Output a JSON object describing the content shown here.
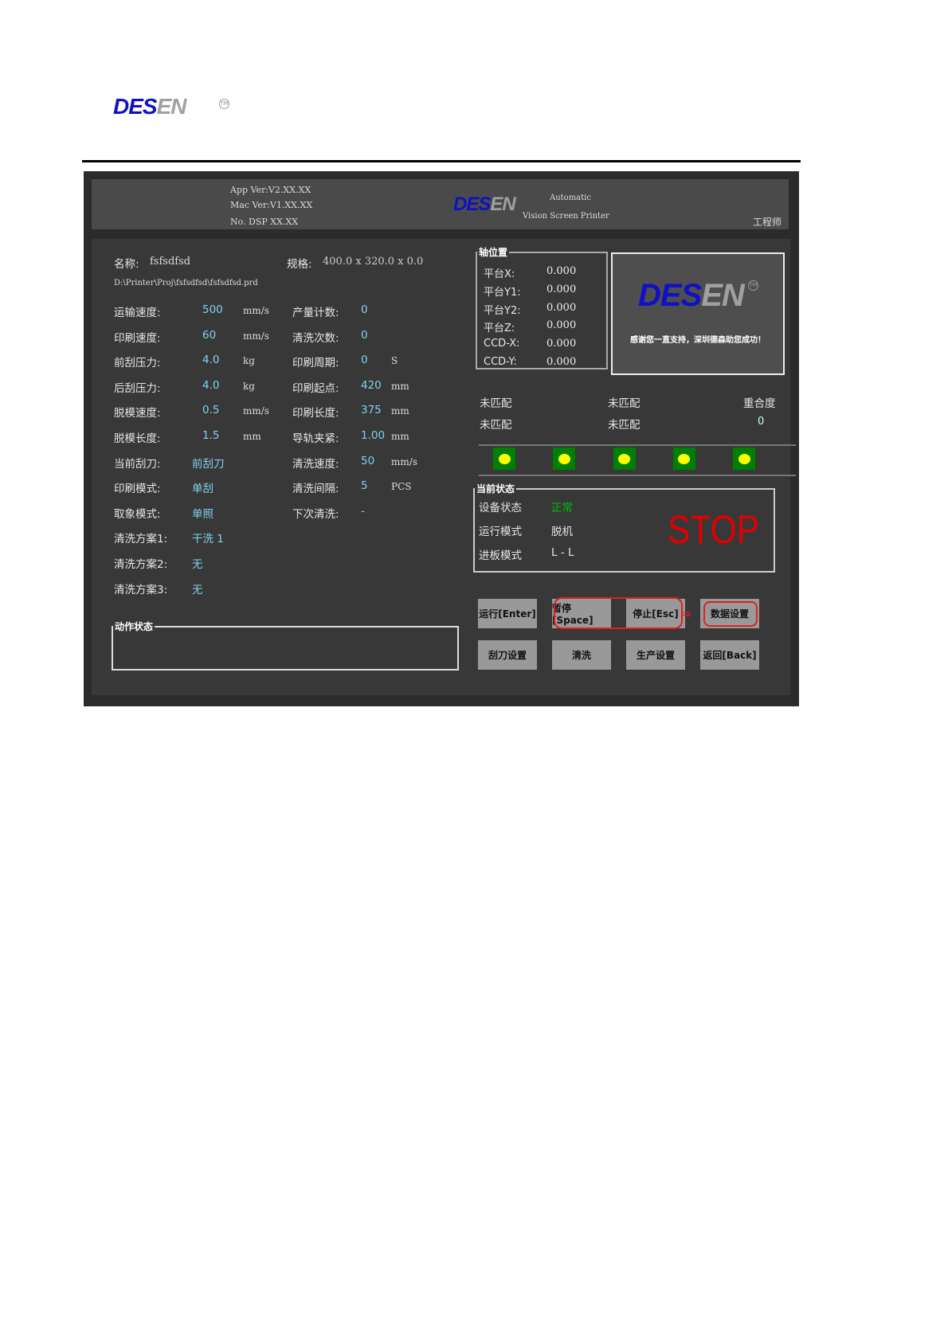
{
  "brand": {
    "logo_a": "DES",
    "logo_b": "EN",
    "tm": "TM"
  },
  "header": {
    "app_ver": "App Ver:V2.XX.XX",
    "mac_ver": "Mac Ver:V1.XX.XX",
    "dsp_no": "No. DSP XX.XX",
    "subtitle1": "Automatic",
    "subtitle2": "Vision Screen Printer",
    "user": "工程师"
  },
  "project": {
    "name_label": "名称:",
    "name": "fsfsdfsd",
    "spec_label": "规格:",
    "spec": "400.0 x 320.0 x 0.0",
    "path": "D:\\Printer\\Proj\\fsfsdfsd\\fsfsdfsd.prd"
  },
  "params_left": [
    {
      "label": "运输速度:",
      "value": "500",
      "unit": "mm/s"
    },
    {
      "label": "印刷速度:",
      "value": "60",
      "unit": "mm/s"
    },
    {
      "label": "前刮压力:",
      "value": "4.0",
      "unit": "kg"
    },
    {
      "label": "后刮压力:",
      "value": "4.0",
      "unit": "kg"
    },
    {
      "label": "脱模速度:",
      "value": "0.5",
      "unit": "mm/s"
    },
    {
      "label": "脱模长度:",
      "value": "1.5",
      "unit": "mm"
    },
    {
      "label": "当前刮刀:",
      "value": "前刮刀",
      "unit": ""
    },
    {
      "label": "印刷模式:",
      "value": "单刮",
      "unit": ""
    },
    {
      "label": "取象模式:",
      "value": "单照",
      "unit": ""
    },
    {
      "label": "清洗方案1:",
      "value": "干洗  1",
      "unit": ""
    },
    {
      "label": "清洗方案2:",
      "value": "无",
      "unit": ""
    },
    {
      "label": "清洗方案3:",
      "value": "无",
      "unit": ""
    }
  ],
  "params_right": [
    {
      "label": "产量计数:",
      "value": "0",
      "unit": ""
    },
    {
      "label": "清洗次数:",
      "value": "0",
      "unit": ""
    },
    {
      "label": "印刷周期:",
      "value": "0",
      "unit": "S"
    },
    {
      "label": "印刷起点:",
      "value": "420",
      "unit": "mm"
    },
    {
      "label": "印刷长度:",
      "value": "375",
      "unit": "mm"
    },
    {
      "label": "导轨夹紧:",
      "value": "1.00",
      "unit": "mm"
    },
    {
      "label": "清洗速度:",
      "value": "50",
      "unit": "mm/s"
    },
    {
      "label": "清洗间隔:",
      "value": "5",
      "unit": "PCS"
    },
    {
      "label": "下次清洗:",
      "value": "-",
      "unit": ""
    }
  ],
  "axis": {
    "title": "轴位置",
    "rows": [
      {
        "label": "平台X:",
        "value": "0.000"
      },
      {
        "label": "平台Y1:",
        "value": "0.000"
      },
      {
        "label": "平台Y2:",
        "value": "0.000"
      },
      {
        "label": "平台Z:",
        "value": "0.000"
      },
      {
        "label": "CCD-X:",
        "value": "0.000"
      },
      {
        "label": "CCD-Y:",
        "value": "0.000"
      }
    ]
  },
  "slogan": "感谢您一直支持，深圳德森助您成功！",
  "match": {
    "a1": "未匹配",
    "a2": "未匹配",
    "b1": "未匹配",
    "b2": "未匹配",
    "overlap_label": "重合度",
    "overlap_value": "0"
  },
  "lights": [
    "on",
    "on",
    "on",
    "on",
    "on"
  ],
  "status": {
    "title": "当前状态",
    "device_label": "设备状态",
    "device_value": "正常",
    "run_label": "运行模式",
    "run_value": "脱机",
    "feed_label": "进板模式",
    "feed_value": "L - L",
    "big": "STOP",
    "colors": {
      "ok": "#00c000",
      "stop": "#e00000"
    }
  },
  "action": {
    "title": "动作状态"
  },
  "buttons": [
    "运行[Enter]",
    "暂停[Space]",
    "停止[Esc]",
    "数据设置",
    "刮刀设置",
    "清洗",
    "生产设置",
    "返回[Back]"
  ]
}
